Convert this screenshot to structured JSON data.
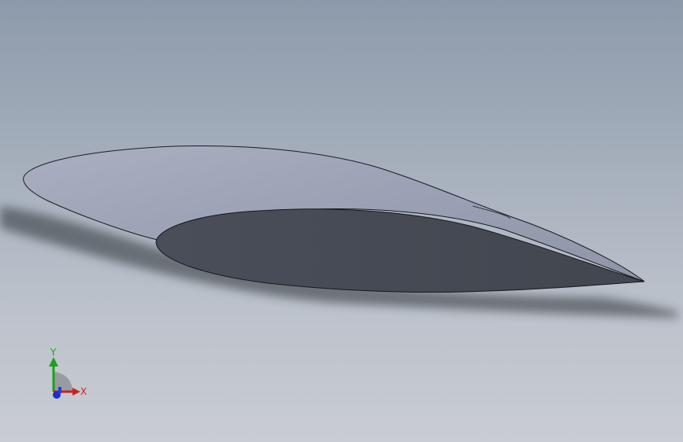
{
  "viewport": {
    "background_top": "#8d9aab",
    "background_bottom": "#c9cdd3"
  },
  "model": {
    "type": "airfoil-wing-section",
    "top_surface_color": "#9fa5b7",
    "end_face_color": "#474b55",
    "edge_color": "#1a1c22"
  },
  "triad": {
    "x_label": "X",
    "y_label": "Y",
    "x_color": "#cc1f1f",
    "y_color": "#1aa31a",
    "z_color": "#1f2fcc"
  }
}
